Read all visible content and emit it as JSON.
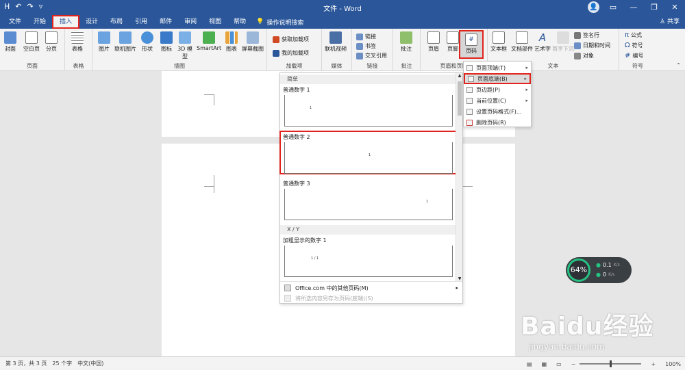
{
  "titlebar": {
    "title": "文件 - Word",
    "qat": [
      "H",
      "↶",
      "↷",
      "▿"
    ],
    "window": [
      "▭",
      "—",
      "❐",
      "✕"
    ],
    "avatar": "👤"
  },
  "tabs": [
    "文件",
    "开始",
    "插入",
    "设计",
    "布局",
    "引用",
    "邮件",
    "审阅",
    "视图",
    "帮助"
  ],
  "tell_me": "操作说明搜索",
  "share": "共享",
  "ribbon": {
    "pages": {
      "label": "页面",
      "btns": [
        "封面",
        "空白页",
        "分页"
      ]
    },
    "tables": {
      "label": "表格",
      "btns": [
        "表格"
      ]
    },
    "illus": {
      "label": "插图",
      "btns": [
        "图片",
        "联机图片",
        "形状",
        "图标",
        "3D 模型",
        "SmartArt",
        "图表",
        "屏幕截图"
      ]
    },
    "addins": {
      "label": "加载项",
      "items": [
        "获取加载项",
        "我的加载项"
      ]
    },
    "media": {
      "label": "媒体",
      "btns": [
        "联机视频"
      ]
    },
    "links": {
      "label": "链接",
      "items": [
        "链接",
        "书签",
        "交叉引用"
      ]
    },
    "comments": {
      "label": "批注",
      "btns": [
        "批注"
      ]
    },
    "hf": {
      "label": "页眉和页脚",
      "btns": [
        "页眉",
        "页脚",
        "页码"
      ]
    },
    "text": {
      "label": "文本",
      "btns": [
        "文本框",
        "文档部件",
        "艺术字",
        "首字下沉"
      ],
      "items": [
        "签名行",
        "日期和时间",
        "对象"
      ]
    },
    "symbols": {
      "label": "符号",
      "items": [
        "公式",
        "符号",
        "编号"
      ]
    }
  },
  "gallery": {
    "cat1": "简单",
    "items": [
      {
        "label": "普通数字 1",
        "num": "1"
      },
      {
        "label": "普通数字 2",
        "num": "1"
      },
      {
        "label": "普通数字 3",
        "num": "1"
      }
    ],
    "cat2": "X / Y",
    "item4": {
      "label": "加粗显示的数字 1",
      "num": "1 / 1"
    },
    "more": "Office.com 中的其他页码(M)",
    "save": "将所选内容另存为页码(底端)(S)"
  },
  "menu": {
    "items": [
      {
        "label": "页面顶端(T)",
        "arrow": "▸"
      },
      {
        "label": "页面底端(B)",
        "arrow": "▸"
      },
      {
        "label": "页边距(P)",
        "arrow": "▸"
      },
      {
        "label": "当前位置(C)",
        "arrow": "▸"
      },
      {
        "label": "设置页码格式(F)...",
        "arrow": ""
      },
      {
        "label": "删除页码(R)",
        "arrow": ""
      }
    ]
  },
  "status": {
    "page": "第 3 页，共 3 页",
    "words": "25 个字",
    "lang": "中文(中国)",
    "zoom": "100%"
  },
  "net": {
    "pct": "64%",
    "up": "0.1",
    "down": "0",
    "unit": "K/s"
  },
  "watermark": {
    "brand": "Baidu经验",
    "url": "jingyan.baidu.com"
  }
}
